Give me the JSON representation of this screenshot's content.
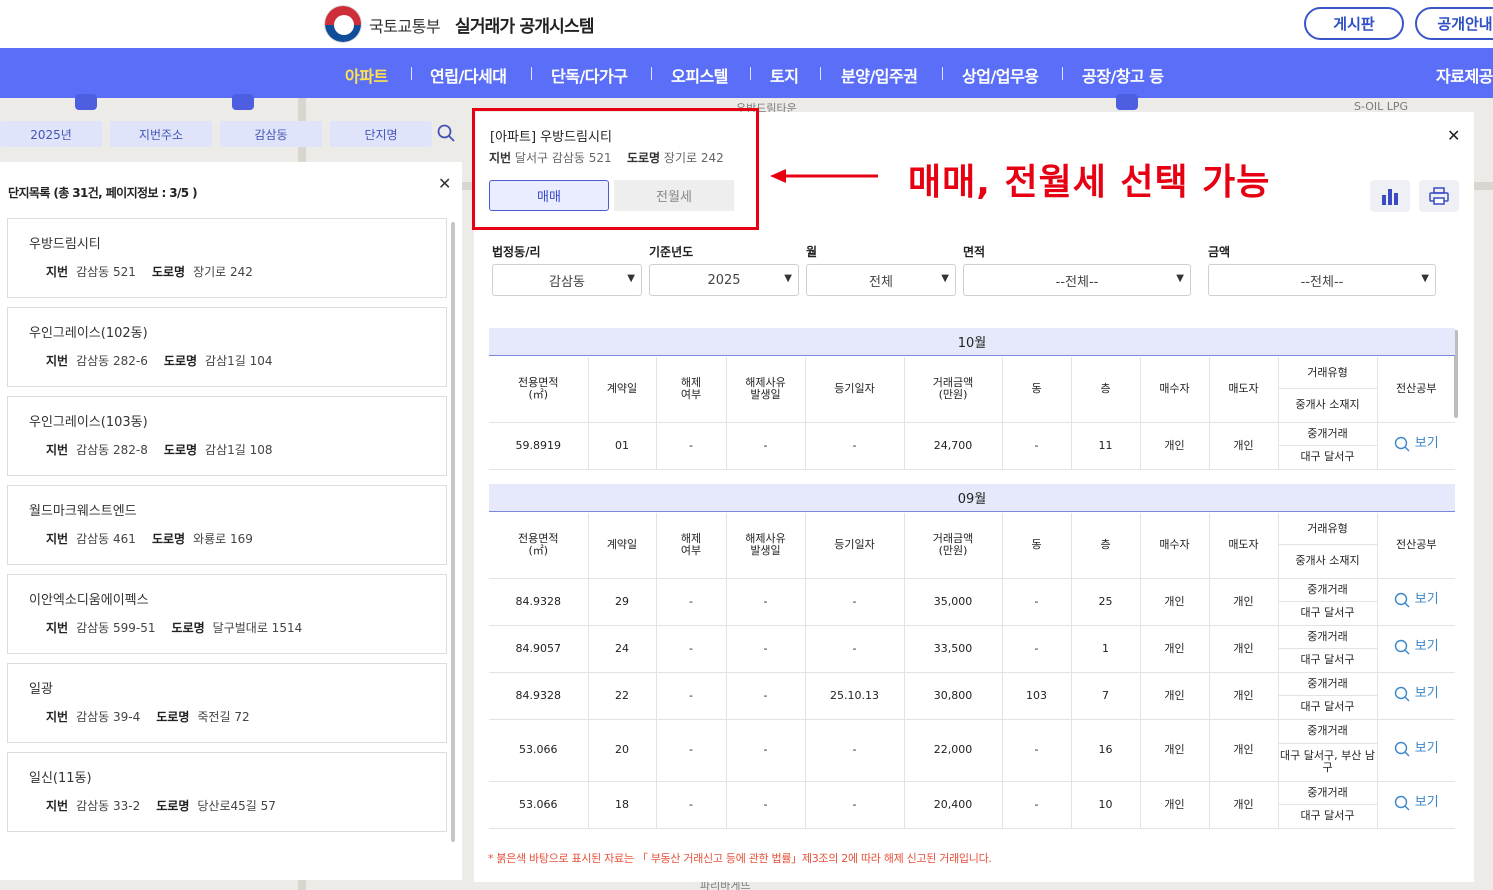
{
  "header": {
    "ministry": "국토교통부",
    "system_title": "실거래가 공개시스템",
    "buttons": [
      "게시판",
      "공개안내"
    ]
  },
  "nav": {
    "items": [
      "아파트",
      "연립/다세대",
      "단독/다가구",
      "오피스텔",
      "토지",
      "분양/입주권",
      "상업/업무용",
      "공장/창고 등"
    ],
    "active": "아파트",
    "right": "자료제공"
  },
  "map_labels": [
    "S-OIL LPG",
    "우방드림타운",
    "파리바게뜨"
  ],
  "search": {
    "chips": [
      "2025년",
      "지번주소",
      "감삼동",
      "단지명"
    ]
  },
  "list": {
    "title": "단지목록 (총 31건, 페이지정보 : 3/5 )",
    "jibun_label": "지번",
    "road_label": "도로명",
    "items": [
      {
        "name": "우방드림시티",
        "jibun": "감삼동 521",
        "road": "장기로 242"
      },
      {
        "name": "우인그레이스(102동)",
        "jibun": "감삼동 282-6",
        "road": "감삼1길 104"
      },
      {
        "name": "우인그레이스(103동)",
        "jibun": "감삼동 282-8",
        "road": "감삼1길 108"
      },
      {
        "name": "월드마크웨스트엔드",
        "jibun": "감삼동 461",
        "road": "와룡로 169"
      },
      {
        "name": "이안엑소디움에이펙스",
        "jibun": "감삼동 599-51",
        "road": "달구벌대로 1514"
      },
      {
        "name": "일광",
        "jibun": "감삼동 39-4",
        "road": "죽전길 72"
      },
      {
        "name": "일신(11동)",
        "jibun": "감삼동 33-2",
        "road": "당산로45길 57"
      }
    ]
  },
  "detail": {
    "title": "[아파트] 우방드림시티",
    "jibun_label": "지번",
    "jibun": "달서구 감삼동 521",
    "road_label": "도로명",
    "road": "장기로 242",
    "tabs": [
      "매매",
      "전월세"
    ],
    "active_tab": "매매"
  },
  "annotation": {
    "text": "매매, 전월세 선택 가능",
    "color": "#e60012"
  },
  "filters": [
    {
      "label": "법정동/리",
      "value": "감삼동"
    },
    {
      "label": "기준년도",
      "value": "2025"
    },
    {
      "label": "월",
      "value": "전체"
    },
    {
      "label": "면적",
      "value": "--전체--"
    },
    {
      "label": "금액",
      "value": "--전체--"
    }
  ],
  "table": {
    "headers": {
      "area": "전용면적\n(㎡)",
      "day": "계약일",
      "cancel": "해제\n여부",
      "cancel_date": "해제사유\n발생일",
      "reg_date": "등기일자",
      "price": "거래금액\n(만원)",
      "dong": "동",
      "floor": "층",
      "buyer": "매수자",
      "seller": "매도자",
      "type": "거래유형",
      "broker": "중개사 소재지",
      "doc": "전산공부"
    },
    "view_label": "보기",
    "months": [
      {
        "month": "10월",
        "rows": [
          {
            "area": "59.8919",
            "day": "01",
            "cancel": "-",
            "cancel_date": "-",
            "reg_date": "-",
            "price": "24,700",
            "dong": "-",
            "floor": "11",
            "buyer": "개인",
            "seller": "개인",
            "type": "중개거래",
            "broker": "대구 달서구"
          }
        ]
      },
      {
        "month": "09월",
        "rows": [
          {
            "area": "84.9328",
            "day": "29",
            "cancel": "-",
            "cancel_date": "-",
            "reg_date": "-",
            "price": "35,000",
            "dong": "-",
            "floor": "25",
            "buyer": "개인",
            "seller": "개인",
            "type": "중개거래",
            "broker": "대구 달서구"
          },
          {
            "area": "84.9057",
            "day": "24",
            "cancel": "-",
            "cancel_date": "-",
            "reg_date": "-",
            "price": "33,500",
            "dong": "-",
            "floor": "1",
            "buyer": "개인",
            "seller": "개인",
            "type": "중개거래",
            "broker": "대구 달서구"
          },
          {
            "area": "84.9328",
            "day": "22",
            "cancel": "-",
            "cancel_date": "-",
            "reg_date": "25.10.13",
            "price": "30,800",
            "dong": "103",
            "floor": "7",
            "buyer": "개인",
            "seller": "개인",
            "type": "중개거래",
            "broker": "대구 달서구"
          },
          {
            "area": "53.066",
            "day": "20",
            "cancel": "-",
            "cancel_date": "-",
            "reg_date": "-",
            "price": "22,000",
            "dong": "-",
            "floor": "16",
            "buyer": "개인",
            "seller": "개인",
            "type": "중개거래",
            "broker": "대구 달서구, 부산 남구"
          },
          {
            "area": "53.066",
            "day": "18",
            "cancel": "-",
            "cancel_date": "-",
            "reg_date": "-",
            "price": "20,400",
            "dong": "-",
            "floor": "10",
            "buyer": "개인",
            "seller": "개인",
            "type": "중개거래",
            "broker": "대구 달서구"
          }
        ]
      }
    ]
  },
  "footnote": "* 붉은색 바탕으로 표시된 자료는 「 부동산 거래신고 등에 관한 법률」제3조의 2에 따라 해제 신고된 거래입니다.",
  "colors": {
    "nav_bg": "#5b6ef7",
    "nav_active": "#ffe14d",
    "accent": "#3b4bc7",
    "footnote": "#e8503a"
  }
}
